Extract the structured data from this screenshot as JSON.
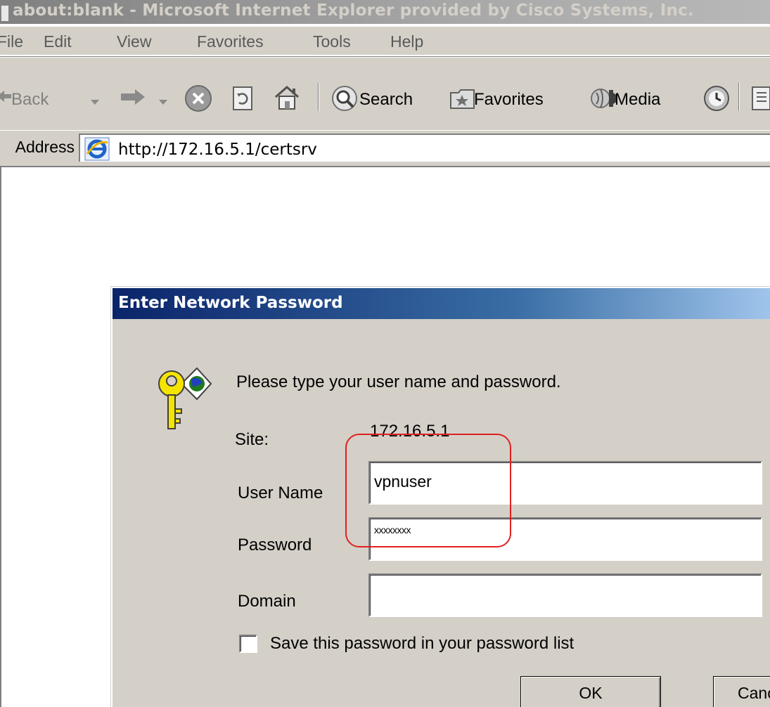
{
  "window": {
    "title": "about:blank - Microsoft Internet Explorer provided by Cisco Systems, Inc."
  },
  "menu": {
    "items": [
      "File",
      "Edit",
      "View",
      "Favorites",
      "Tools",
      "Help"
    ]
  },
  "toolbar": {
    "back_label": "Back",
    "search_label": "Search",
    "favorites_label": "Favorites",
    "media_label": "Media"
  },
  "address": {
    "label": "Address",
    "url": "http://172.16.5.1/certsrv"
  },
  "dialog": {
    "title": "Enter Network Password",
    "prompt": "Please type your user name and password.",
    "site_label": "Site:",
    "site_value": "172.16.5.1",
    "username_label": "User Name",
    "username_value": "vpnuser",
    "password_label": "Password",
    "password_value": "xxxxxxxx",
    "domain_label": "Domain",
    "domain_value": "",
    "save_password_label": "Save this password in your password list",
    "save_password_checked": false,
    "ok_label": "OK",
    "cancel_label": "Cancel"
  },
  "colors": {
    "highlight": "#e02020",
    "dialog_title_start": "#0a246a",
    "dialog_title_end": "#a6caf0",
    "face": "#d4d0c8"
  }
}
